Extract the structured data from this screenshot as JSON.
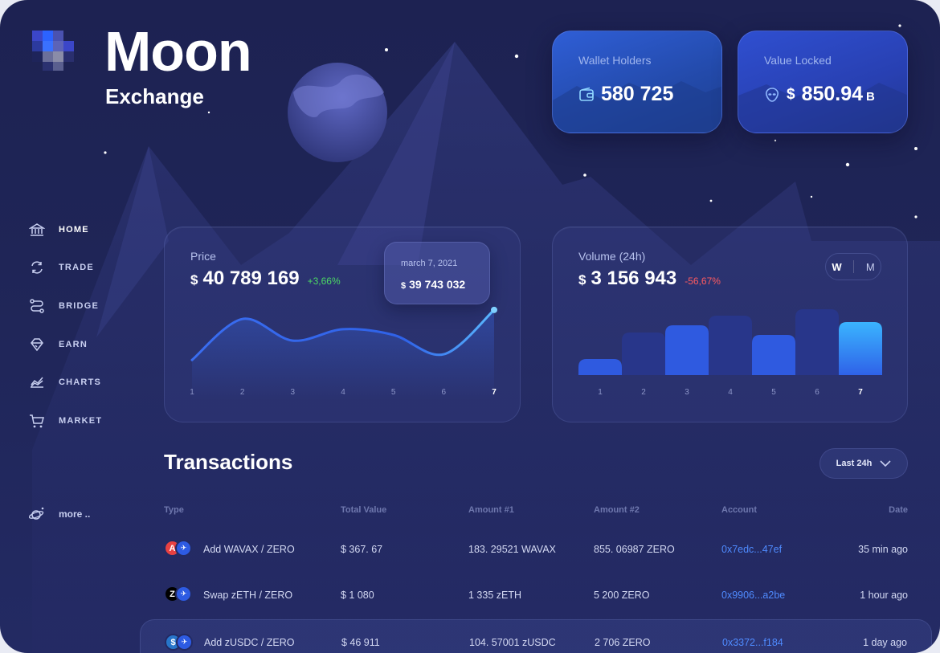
{
  "brand": {
    "title": "Moon",
    "subtitle": "Exchange"
  },
  "stats": [
    {
      "label": "Wallet Holders",
      "value": "580 725",
      "icon": "wallet-icon"
    },
    {
      "label": "Value Locked",
      "currency": "$",
      "value": "850.94",
      "suffix": "B",
      "icon": "alien-coin-icon"
    }
  ],
  "nav": {
    "items": [
      {
        "label": "HOME",
        "icon": "bank-icon",
        "active": true
      },
      {
        "label": "TRADE",
        "icon": "swap-icon"
      },
      {
        "label": "BRIDGE",
        "icon": "route-icon"
      },
      {
        "label": "EARN",
        "icon": "diamond-icon"
      },
      {
        "label": "CHARTS",
        "icon": "chart-icon"
      },
      {
        "label": "MARKET",
        "icon": "cart-icon"
      }
    ],
    "more": "more .."
  },
  "price": {
    "label": "Price",
    "currency": "$",
    "value": "40 789 169",
    "change": "+3,66%",
    "tooltip": {
      "date": "march 7, 2021",
      "currency": "$",
      "value": "39 743 032"
    }
  },
  "volume": {
    "label": "Volume (24h)",
    "currency": "$",
    "value": "3 156 943",
    "change": "-56,67%",
    "toggle": [
      "W",
      "M"
    ]
  },
  "colors": {
    "accent": "#3a6df0",
    "positive": "#4cd964",
    "negative": "#ff5a5f",
    "link": "#4f8bff"
  },
  "chart_data": [
    {
      "type": "line",
      "x": [
        "1",
        "2",
        "3",
        "4",
        "5",
        "6",
        "7"
      ],
      "values": [
        0.28,
        1.0,
        0.62,
        0.82,
        0.72,
        0.38,
        1.16
      ],
      "highlight": "7"
    },
    {
      "type": "bar",
      "categories": [
        "1",
        "2",
        "3",
        "4",
        "5",
        "6",
        "7"
      ],
      "values": [
        20,
        53,
        62,
        74,
        50,
        82,
        66
      ],
      "highlight": "7"
    }
  ],
  "transactions": {
    "title": "Transactions",
    "filter": "Last 24h",
    "columns": [
      "Type",
      "Total Value",
      "Amount #1",
      "Amount #2",
      "Account",
      "Date"
    ],
    "rows": [
      {
        "type": "Add WAVAX / ZERO",
        "coin": "A",
        "total": "$ 367. 67",
        "amount1": "183. 29521 WAVAX",
        "amount2": "855. 06987 ZERO",
        "account": "0x7edc...47ef",
        "date": "35 min ago"
      },
      {
        "type": "Swap zETH / ZERO",
        "coin": "Z",
        "total": "$ 1 080",
        "amount1": "1 335 zETH",
        "amount2": "5 200 ZERO",
        "account": "0x9906...a2be",
        "date": "1 hour ago"
      },
      {
        "type": "Add zUSDC / ZERO",
        "coin": "$",
        "total": "$ 46 911",
        "amount1": "104. 57001 zUSDC",
        "amount2": "2 706 ZERO",
        "account": "0x3372...f184",
        "date": "1 day ago"
      }
    ]
  }
}
